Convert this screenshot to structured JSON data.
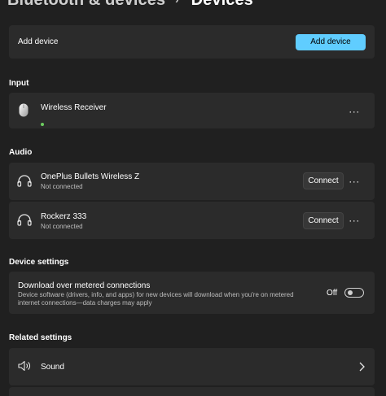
{
  "breadcrumb": {
    "parent": "Bluetooth & devices",
    "separator": "›",
    "current": "Devices"
  },
  "add_device": {
    "label": "Add device",
    "button_label": "Add device"
  },
  "input_section": {
    "title": "Input",
    "devices": [
      {
        "name": "Wireless Receiver",
        "status": "",
        "icon": "mouse-icon",
        "more": "···"
      }
    ]
  },
  "audio_section": {
    "title": "Audio",
    "devices": [
      {
        "name": "OnePlus Bullets Wireless Z",
        "status": "Not connected",
        "icon": "headphones-icon",
        "button": "Connect",
        "more": "···"
      },
      {
        "name": "Rockerz 333",
        "status": "Not connected",
        "icon": "headphones-icon",
        "button": "Connect",
        "more": "···"
      }
    ]
  },
  "device_settings": {
    "title": "Device settings",
    "metered": {
      "title": "Download over metered connections",
      "description_line1": "Device software (drivers, info, and apps) for new devices will download when you're on metered",
      "description_line2": "internet connections—data charges may apply",
      "toggle_label": "Off",
      "toggle_on": false
    }
  },
  "related_settings": {
    "title": "Related settings",
    "items": [
      {
        "label": "Sound",
        "icon": "speaker-icon"
      }
    ]
  },
  "colors": {
    "accent": "#60cdff",
    "background": "#202020",
    "card": "#2b2b2b",
    "connected_dot": "#6ccb5f"
  }
}
